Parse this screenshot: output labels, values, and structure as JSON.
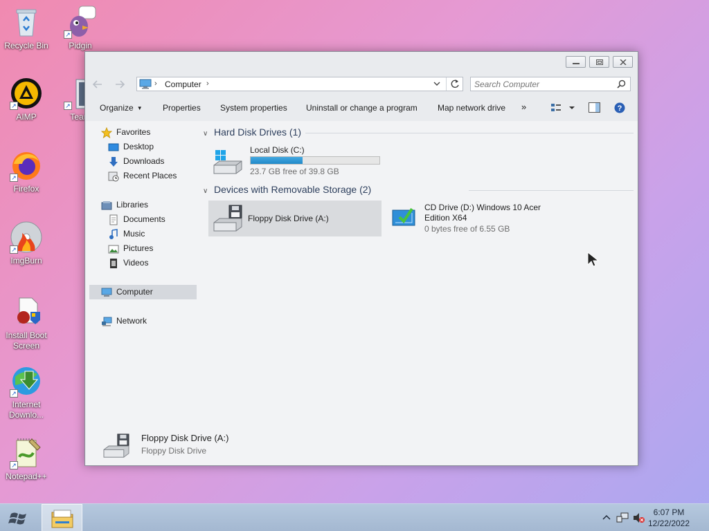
{
  "desktop": {
    "icons": [
      {
        "label": "Recycle Bin",
        "icon": "recycle-bin-icon"
      },
      {
        "label": "Pidgin",
        "icon": "pidgin-icon"
      },
      {
        "label": "AIMP",
        "icon": "aimp-icon"
      },
      {
        "label": "Team",
        "icon": "teamviewer-icon"
      },
      {
        "label": "Firefox",
        "icon": "firefox-icon"
      },
      {
        "label": "ImgBurn",
        "icon": "imgburn-icon"
      },
      {
        "label": "Install Boot Screen",
        "icon": "install-boot-screen-icon"
      },
      {
        "label": "Internet Downlo...",
        "icon": "internet-download-manager-icon"
      },
      {
        "label": "Notepad++",
        "icon": "notepadpp-icon"
      }
    ]
  },
  "window": {
    "address": {
      "crumb": "Computer"
    },
    "search": {
      "placeholder": "Search Computer"
    },
    "toolbar": {
      "organize": "Organize",
      "properties": "Properties",
      "system_properties": "System properties",
      "uninstall": "Uninstall or change a program",
      "map_network_drive": "Map network drive",
      "more": "»"
    },
    "nav": {
      "favorites": "Favorites",
      "desktop": "Desktop",
      "downloads": "Downloads",
      "recent_places": "Recent Places",
      "libraries": "Libraries",
      "documents": "Documents",
      "music": "Music",
      "pictures": "Pictures",
      "videos": "Videos",
      "computer": "Computer",
      "network": "Network"
    },
    "groups": {
      "hard_disks": "Hard Disk Drives (1)",
      "removable": "Devices with Removable Storage (2)"
    },
    "drives": {
      "local": {
        "name": "Local Disk (C:)",
        "info": "23.7 GB free of 39.8 GB",
        "used_fraction": 0.405
      },
      "floppy": {
        "name": "Floppy Disk Drive (A:)"
      },
      "cd": {
        "name_line1": "CD Drive (D:) Windows 10 Acer",
        "name_line2": "Edition X64",
        "info": "0 bytes free of 6.55 GB"
      }
    },
    "details": {
      "name": "Floppy Disk Drive (A:)",
      "type": "Floppy Disk Drive"
    }
  },
  "taskbar": {
    "time": "6:07 PM",
    "date": "12/22/2022"
  },
  "colors": {
    "accent": "#2189c9",
    "selection": "#d9dbde"
  }
}
